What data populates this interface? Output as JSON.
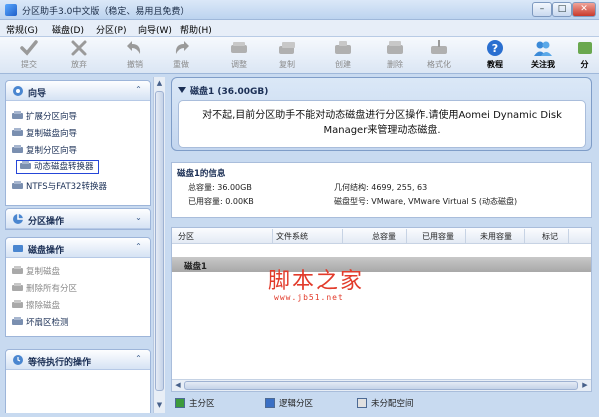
{
  "window": {
    "title": "分区助手3.0中文版（稳定、易用且免费）",
    "min_label": "–",
    "max_label": "□",
    "close_label": "✕"
  },
  "menu": [
    "常规(G)",
    "磁盘(D)",
    "分区(P)",
    "向导(W)",
    "帮助(H)"
  ],
  "toolbar": {
    "submit": "提交",
    "discard": "放弃",
    "undo": "撤销",
    "redo": "重做",
    "resize": "调整",
    "copy": "复制",
    "create": "创建",
    "delete": "删除",
    "format": "格式化",
    "tutorial": "教程",
    "follow": "关注我",
    "share": "分"
  },
  "sidebar": {
    "wizard": {
      "title": "向导",
      "items": [
        {
          "label": "扩展分区向导"
        },
        {
          "label": "复制磁盘向导"
        },
        {
          "label": "复制分区向导"
        },
        {
          "label": "动态磁盘转换器"
        },
        {
          "label": "NTFS与FAT32转换器"
        }
      ]
    },
    "partition_ops": {
      "title": "分区操作"
    },
    "disk_ops": {
      "title": "磁盘操作",
      "items": [
        {
          "label": "复制磁盘"
        },
        {
          "label": "删除所有分区"
        },
        {
          "label": "擦除磁盘"
        },
        {
          "label": "坏扇区检测"
        }
      ]
    },
    "pending": {
      "title": "等待执行的操作"
    }
  },
  "main": {
    "disk_header": "磁盘1 (36.00GB)",
    "warning": "对不起,目前分区助手不能对动态磁盘进行分区操作.请使用Aomei Dynamic Disk Manager来管理动态磁盘.",
    "info": {
      "title": "磁盘1的信息",
      "total_label": "总容量: 36.00GB",
      "used_label": "已用容量: 0.00KB",
      "geometry_label": "几何结构: 4699, 255, 63",
      "model_label": "磁盘型号: VMware, VMware Virtual S (动态磁盘)"
    },
    "table": {
      "columns": [
        "分区",
        "文件系统",
        "总容量",
        "已用容量",
        "未用容量",
        "标记"
      ],
      "disk_row": "磁盘1"
    },
    "legend": {
      "primary": "主分区",
      "logical": "逻辑分区",
      "unallocated": "未分配空间",
      "colors": {
        "primary": "#3c9a3c",
        "logical": "#3a6fc4",
        "unallocated": "#e0e0e0"
      }
    }
  },
  "watermark": {
    "line1": "脚本之家",
    "line2": "www.jb51.net"
  }
}
